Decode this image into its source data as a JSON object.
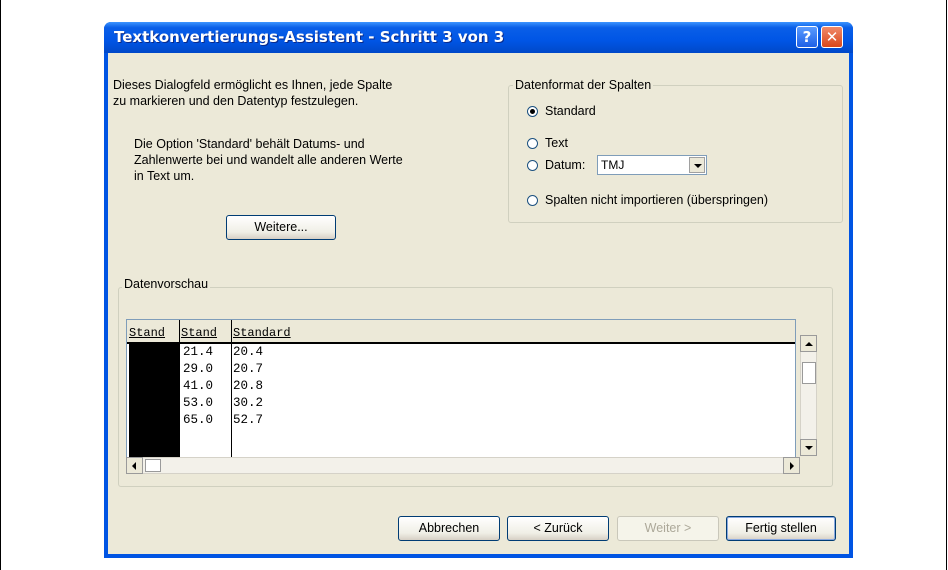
{
  "window": {
    "title": "Textkonvertierungs-Assistent - Schritt 3 von 3",
    "help_icon": "?",
    "close_icon": "✕"
  },
  "description": {
    "line1": "Dieses Dialogfeld ermöglicht es Ihnen, jede Spalte",
    "line2": "zu markieren und den Datentyp festzulegen.",
    "info_line1": "Die Option 'Standard' behält Datums- und",
    "info_line2": "Zahlenwerte bei und wandelt alle anderen Werte",
    "info_line3": "in Text um."
  },
  "buttons": {
    "advanced": "Weitere...",
    "cancel": "Abbrechen",
    "back": "< Zurück",
    "next": "Weiter >",
    "finish": "Fertig stellen"
  },
  "column_format": {
    "legend": "Datenformat der Spalten",
    "options": [
      "Standard",
      "Text",
      "Datum:",
      "Spalten nicht importieren (überspringen)"
    ],
    "selected_index": 0,
    "date_format": "TMJ"
  },
  "preview": {
    "legend": "Datenvorschau",
    "headers": [
      "Stand",
      "Stand",
      "Standard"
    ],
    "rows": [
      [
        "",
        "21.4",
        "20.4"
      ],
      [
        "",
        "29.0",
        "20.7"
      ],
      [
        "",
        "41.0",
        "20.8"
      ],
      [
        "",
        "53.0",
        "30.2"
      ],
      [
        "",
        "65.0",
        "52.7"
      ]
    ]
  },
  "colors": {
    "titlebar": "#0054e3",
    "dialog_bg": "#ece9d8",
    "close_button": "#d9461a"
  }
}
